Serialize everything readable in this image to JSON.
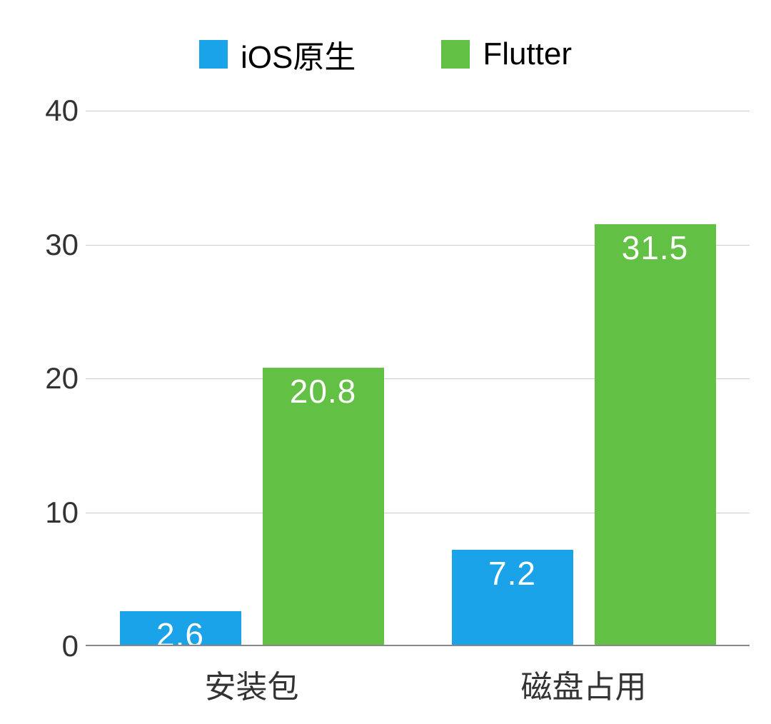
{
  "chart_data": {
    "type": "bar",
    "categories": [
      "安装包",
      "磁盘占用"
    ],
    "series": [
      {
        "name": "iOS原生",
        "values": [
          2.6,
          7.2
        ],
        "color": "#1aa3e8"
      },
      {
        "name": "Flutter",
        "values": [
          20.8,
          31.5
        ],
        "color": "#62c144"
      }
    ],
    "ylim": [
      0,
      40
    ],
    "y_ticks": [
      0,
      10,
      20,
      30,
      40
    ],
    "xlabel": "",
    "ylabel": "",
    "title": "",
    "legend_position": "top"
  }
}
